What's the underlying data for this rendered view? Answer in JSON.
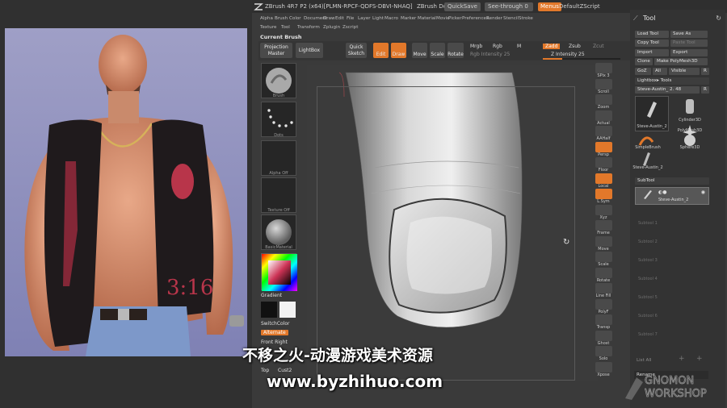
{
  "app": {
    "title": "ZBrush 4R7 P2 (x64)[PLMN-RPCF-QDFS-DBVI-NHAQ]",
    "doc_label": "ZBrush Document",
    "quicksave": "QuickSave",
    "see_through": "See-through",
    "see_through_value": "0",
    "menus_label": "Menus",
    "default_zscript": "DefaultZScript"
  },
  "menubar": {
    "row1": [
      "Alpha",
      "Brush",
      "Color",
      "Document",
      "Draw",
      "Edit",
      "File",
      "Layer",
      "Light",
      "Macro",
      "Marker",
      "Material",
      "Movie",
      "Picker",
      "Preferences",
      "Render",
      "Stencil",
      "Stroke"
    ],
    "row2": [
      "Texture",
      "Tool",
      "Transform",
      "Zplugin",
      "Zscript"
    ]
  },
  "current_brush_label": "Current Brush",
  "toolbar": {
    "projection_master": "Projection Master",
    "lightbox": "LightBox",
    "quick_sketch": "Quick Sketch",
    "edit": "Edit",
    "draw": "Draw",
    "move": "Move",
    "scale": "Scale",
    "rotate": "Rotate",
    "mrgb": "Mrgb",
    "rgb": "Rgb",
    "m": "M",
    "rgb_intensity": "Rgb Intensity 25",
    "zadd": "Zadd",
    "zsub": "Zsub",
    "zcut": "Zcut",
    "z_intensity": "Z Intensity 25"
  },
  "left_shelf": {
    "brush_label": "Brush",
    "dots_label": "Dots",
    "alpha_off": "Alpha Off",
    "texture_off": "Texture Off",
    "material_label": "BasicMaterial",
    "gradient": "Gradient",
    "switch_color": "SwitchColor",
    "alternate": "Alternate",
    "front_right": "Front Right",
    "top": "Top",
    "cust2": "Cust2"
  },
  "right_shelf": {
    "labels": [
      "SPix 3",
      "Scroll",
      "Zoom",
      "Actual",
      "AAHalf",
      "Persp",
      "Floor",
      "Local",
      "L.Sym",
      "Xyz",
      "Frame",
      "Move",
      "Scale",
      "Rotate",
      "Line Fill",
      "PolyF",
      "Transp",
      "Ghost",
      "Solo",
      "Xpose"
    ]
  },
  "tool_panel": {
    "title": "Tool",
    "load_tool": "Load Tool",
    "save_as": "Save As",
    "copy_tool": "Copy Tool",
    "paste_tool": "Paste Tool",
    "import": "Import",
    "export": "Export",
    "clone": "Clone",
    "make_polymesh": "Make PolyMesh3D",
    "goz": "GoZ",
    "all": "All",
    "visible": "Visible",
    "r": "R",
    "lightbox_tools": "Lightbox▸ Tools",
    "current_tool": "Steve-Austin_ 2. 48",
    "thumb_main": "Steve-Austin_2",
    "thumb_cylinder": "Cylinder3D",
    "thumb_polymesh": "PolyMesh3D",
    "thumb_zsphere": "ZSphere",
    "thumb_simplebrush": "SimpleBrush",
    "thumb_sphere": "Sphere3D",
    "thumb_austin2": "Steve-Austin_2",
    "subtool": "SubTool",
    "subtool_item": "Steve-Austin_2",
    "subtool_slots": [
      "Subtool 1",
      "Subtool 2",
      "Subtool 3",
      "Subtool 4",
      "Subtool 5",
      "Subtool 6",
      "Subtool 7"
    ],
    "list_all": "List All",
    "rename": "Rename"
  },
  "watermark": {
    "line1": "不移之火-动漫游戏美术资源",
    "line2": "www.byzhihuo.com",
    "logo_top": "GNOMON",
    "logo_bottom": "WORKSHOP"
  },
  "colors": {
    "accent": "#e2782a",
    "panel": "#333333",
    "button": "#4b4b4b"
  }
}
